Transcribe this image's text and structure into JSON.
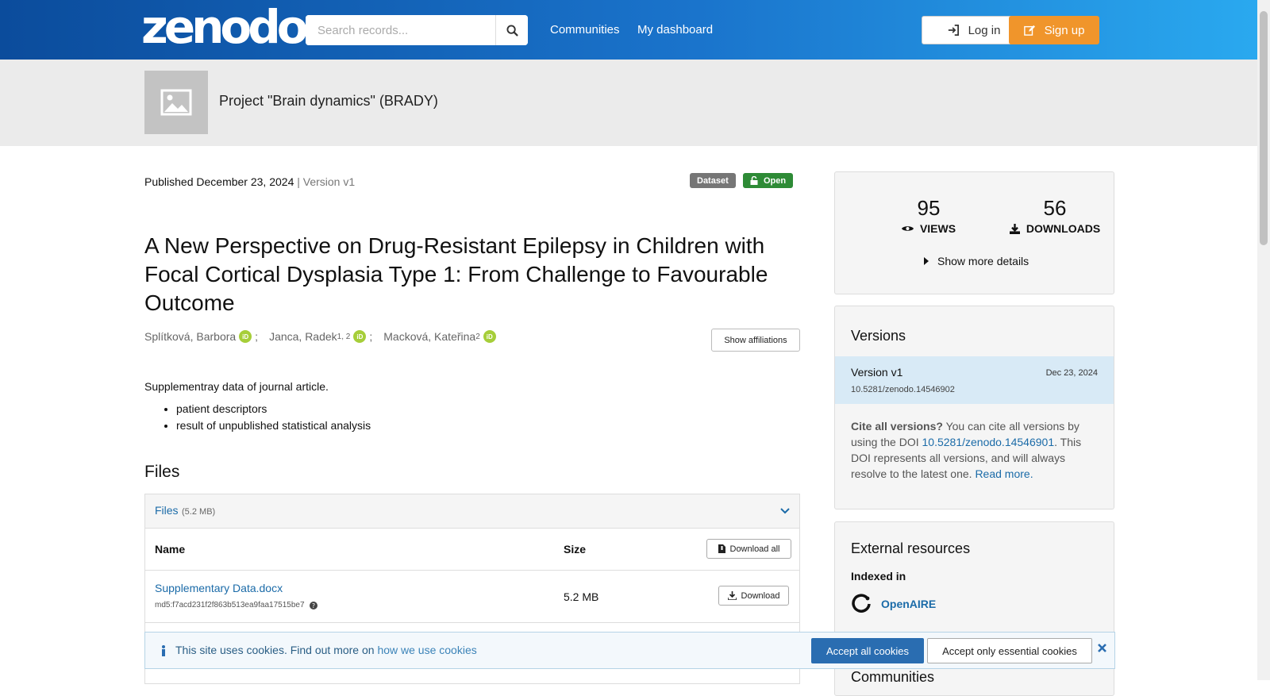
{
  "header": {
    "logo": "zenodo",
    "search_placeholder": "Search records...",
    "nav": [
      "Communities",
      "My dashboard"
    ],
    "login_label": "Log in",
    "signup_label": "Sign up"
  },
  "community": {
    "title": "Project \"Brain dynamics\" (BRADY)"
  },
  "record": {
    "published_label": "Published",
    "published_date": "December 23, 2024",
    "version_text": "| Version v1",
    "badge_type": "Dataset",
    "badge_access": "Open",
    "title": "A New Perspective on Drug-Resistant Epilepsy in Children with Focal Cortical Dysplasia Type 1: From Challenge to Favourable Outcome",
    "creators": [
      {
        "name": "Splítková, Barbora",
        "sup": ""
      },
      {
        "name": "Janca, Radek",
        "sup": "1, 2"
      },
      {
        "name": "Macková, Kateřina",
        "sup": "2"
      }
    ],
    "creator_separator": ";",
    "orcid_label": "iD",
    "show_affiliations": "Show affiliations",
    "description": "Supplementray data of journal article.",
    "bullets": [
      "patient descriptors",
      "result of unpublished statistical analysis"
    ]
  },
  "files": {
    "heading": "Files",
    "panel_label": "Files",
    "panel_size": "(5.2 MB)",
    "col_name": "Name",
    "col_size": "Size",
    "download_all": "Download all",
    "rows": [
      {
        "name": "Supplementary Data.docx",
        "checksum": "md5:f7acd231f2f863b513ea9faa17515be7",
        "size": "5.2 MB",
        "action": "Download"
      }
    ]
  },
  "stats": {
    "views": "95",
    "views_label": "VIEWS",
    "downloads": "56",
    "downloads_label": "DOWNLOADS",
    "show_more": "Show more details"
  },
  "versions": {
    "heading": "Versions",
    "current_label": "Version v1",
    "current_date": "Dec 23, 2024",
    "current_doi": "10.5281/zenodo.14546902",
    "cite_bold": "Cite all versions?",
    "cite_text1": " You can cite all versions by using the DOI ",
    "cite_doi": "10.5281/zenodo.14546901",
    "cite_text2": ". This DOI represents all versions, and will always resolve to the latest one. ",
    "read_more": "Read more."
  },
  "external": {
    "heading": "External resources",
    "indexed_in": "Indexed in",
    "resource": "OpenAIRE"
  },
  "communities_heading": "Communities",
  "cookie": {
    "text": "This site uses cookies. Find out more on ",
    "link": "how we use cookies",
    "accept_all": "Accept all cookies",
    "accept_essential": "Accept only essential cookies"
  },
  "colors": {
    "accent": "#1b6ba8",
    "signup": "#f0952b",
    "open_badge": "#2e8b36",
    "dataset_badge": "#767676"
  }
}
